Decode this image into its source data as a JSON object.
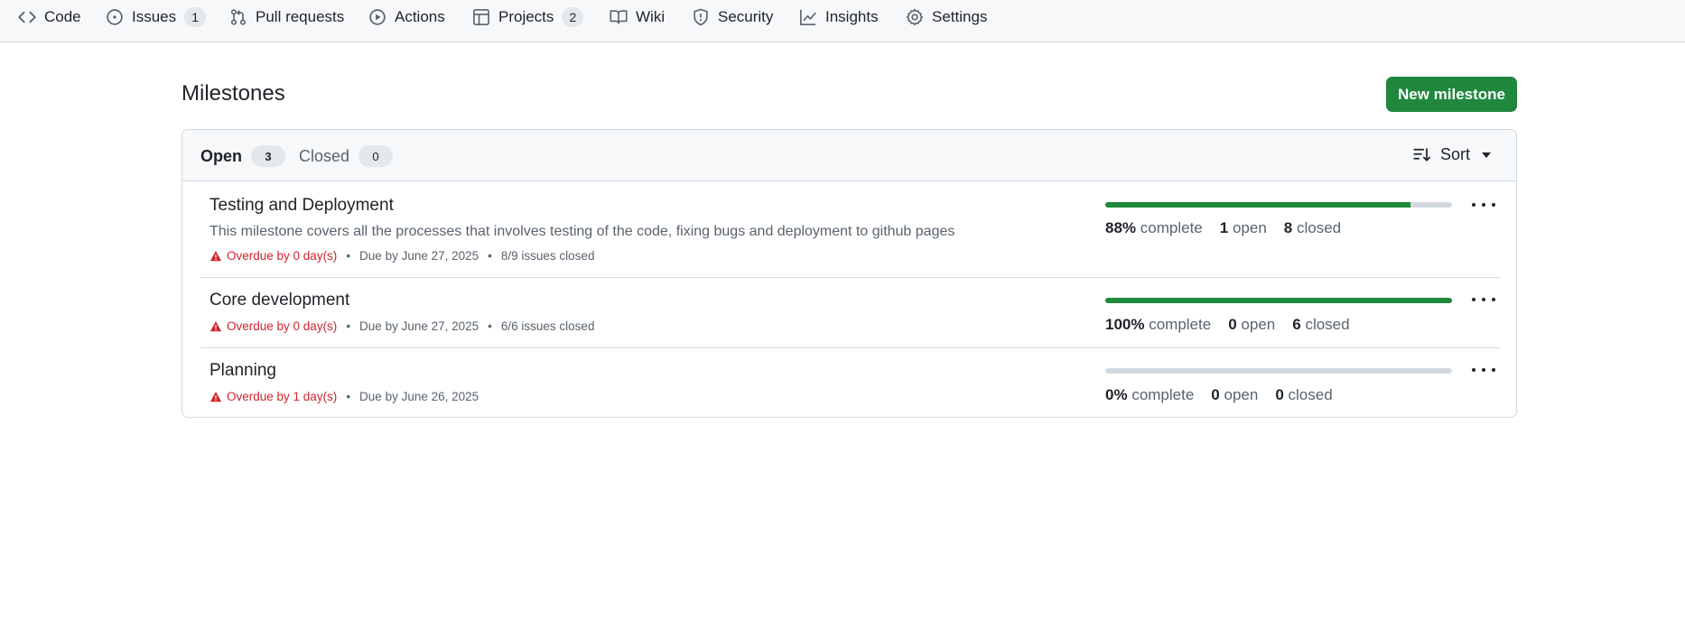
{
  "nav": {
    "tabs": [
      {
        "label": "Code",
        "icon": "code-icon",
        "counter": null
      },
      {
        "label": "Issues",
        "icon": "issue-opened-icon",
        "counter": "1"
      },
      {
        "label": "Pull requests",
        "icon": "git-pull-request-icon",
        "counter": null
      },
      {
        "label": "Actions",
        "icon": "play-icon",
        "counter": null
      },
      {
        "label": "Projects",
        "icon": "table-icon",
        "counter": "2"
      },
      {
        "label": "Wiki",
        "icon": "book-icon",
        "counter": null
      },
      {
        "label": "Security",
        "icon": "shield-icon",
        "counter": null
      },
      {
        "label": "Insights",
        "icon": "graph-icon",
        "counter": null
      },
      {
        "label": "Settings",
        "icon": "gear-icon",
        "counter": null
      }
    ]
  },
  "header": {
    "title": "Milestones",
    "new_button": "New milestone"
  },
  "filters": {
    "open_label": "Open",
    "open_count": "3",
    "closed_label": "Closed",
    "closed_count": "0",
    "sort_label": "Sort"
  },
  "milestones": [
    {
      "title": "Testing and Deployment",
      "description": "This milestone covers all the processes that involves testing of the code, fixing bugs and deployment to github pages",
      "overdue": "Overdue by 0 day(s)",
      "due": "Due by June 27, 2025",
      "issues_closed": "8/9 issues closed",
      "progress": 0.88,
      "percent": "88%",
      "complete_label": "complete",
      "open_count": "1",
      "open_label": "open",
      "closed_count": "8",
      "closed_label": "closed"
    },
    {
      "title": "Core development",
      "description": "",
      "overdue": "Overdue by 0 day(s)",
      "due": "Due by June 27, 2025",
      "issues_closed": "6/6 issues closed",
      "progress": 1.0,
      "percent": "100%",
      "complete_label": "complete",
      "open_count": "0",
      "open_label": "open",
      "closed_count": "6",
      "closed_label": "closed"
    },
    {
      "title": "Planning",
      "description": "",
      "overdue": "Overdue by 1 day(s)",
      "due": "Due by June 26, 2025",
      "issues_closed": "",
      "progress": 0.0,
      "percent": "0%",
      "complete_label": "complete",
      "open_count": "0",
      "open_label": "open",
      "closed_count": "0",
      "closed_label": "closed"
    }
  ],
  "colors": {
    "accent_green": "#1f883d",
    "danger_red": "#d1242f",
    "muted_text": "#59636e",
    "border": "#d1d9e0"
  }
}
